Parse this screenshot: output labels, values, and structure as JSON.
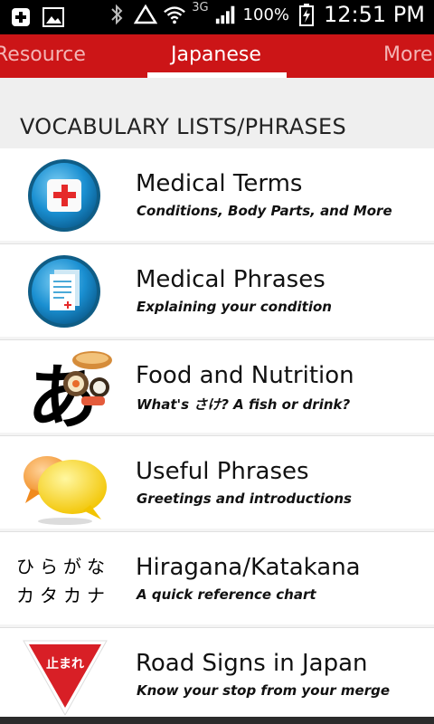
{
  "status_bar": {
    "network": "3G",
    "battery_percent": "100%",
    "time": "12:51 PM"
  },
  "tabs": {
    "left": "Resource",
    "active": "Japanese",
    "right": "More"
  },
  "section": {
    "title": "VOCABULARY LISTS/PHRASES"
  },
  "items": [
    {
      "title": "Medical Terms",
      "subtitle": "Conditions, Body Parts, and More",
      "icon": "medical-kit-icon"
    },
    {
      "title": "Medical Phrases",
      "subtitle": "Explaining your condition",
      "icon": "medical-document-icon"
    },
    {
      "title": "Food and Nutrition",
      "subtitle": "What's さけ? A fish or drink?",
      "icon": "food-hiragana-icon"
    },
    {
      "title": "Useful Phrases",
      "subtitle": "Greetings and introductions",
      "icon": "speech-bubbles-icon"
    },
    {
      "title": "Hiragana/Katakana",
      "subtitle": "A quick reference chart",
      "icon": "kana-chart-icon",
      "kana_line1": "ひらがな",
      "kana_line2": "カタカナ"
    },
    {
      "title": "Road Signs in Japan",
      "subtitle": "Know your stop from your merge",
      "icon": "stop-sign-icon",
      "sign_text": "止まれ"
    }
  ],
  "colors": {
    "tab_bar": "#cc1517",
    "section_bg": "#efefef"
  }
}
